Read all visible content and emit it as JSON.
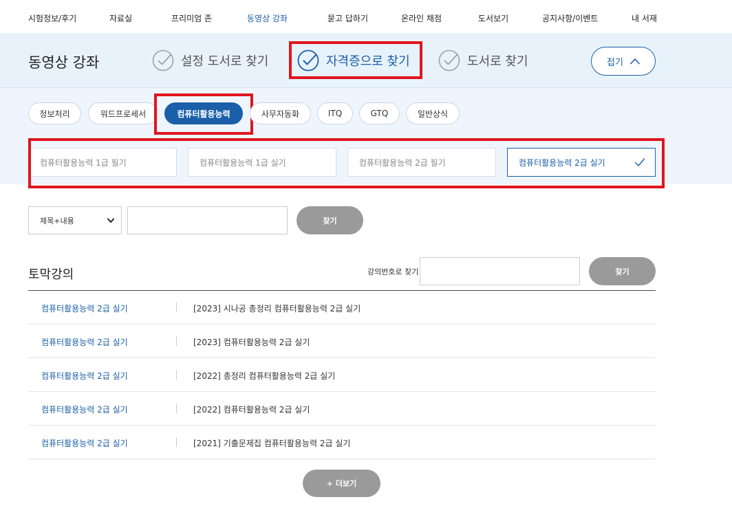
{
  "nav": {
    "items": [
      {
        "label": "시험정보/후기"
      },
      {
        "label": "자료실"
      },
      {
        "label": "프리미엄 존"
      },
      {
        "label": "동영상 강좌"
      },
      {
        "label": "묻고 답하기"
      },
      {
        "label": "온라인 채점"
      },
      {
        "label": "도서보기"
      },
      {
        "label": "공지사항/이벤트"
      },
      {
        "label": "내 서재"
      }
    ],
    "active": "동영상 강좌"
  },
  "header": {
    "title": "동영상 강좌",
    "modes": [
      {
        "label": "설정 도서로 찾기",
        "selected": false
      },
      {
        "label": "자격증으로 찾기",
        "selected": true
      },
      {
        "label": "도서로 찾기",
        "selected": false
      }
    ],
    "fold_label": "접기"
  },
  "categories": [
    {
      "label": "정보처리"
    },
    {
      "label": "워드프로세서"
    },
    {
      "label": "컴퓨터활용능력"
    },
    {
      "label": "사무자동화"
    },
    {
      "label": "ITQ"
    },
    {
      "label": "GTQ"
    },
    {
      "label": "일반상식"
    }
  ],
  "active_category": "컴퓨터활용능력",
  "levels": [
    {
      "label": "컴퓨터활용능력 1급 필기"
    },
    {
      "label": "컴퓨터활용능력 1급 실기"
    },
    {
      "label": "컴퓨터활용능력 2급 필기"
    },
    {
      "label": "컴퓨터활용능력 2급 실기"
    }
  ],
  "active_level": "컴퓨터활용능력 2급 실기",
  "search": {
    "select_value": "제목+내용",
    "input_value": "",
    "button_label": "찾기"
  },
  "section": {
    "title": "토막강의",
    "lecture_number_label": "강의번호로 찾기",
    "lecture_number_value": "",
    "button_label": "찾기"
  },
  "lectures": [
    {
      "category": "컴퓨터활용능력 2급 실기",
      "title": "[2023] 시나공 총정리 컴퓨터활용능력 2급 실기"
    },
    {
      "category": "컴퓨터활용능력 2급 실기",
      "title": "[2023] 컴퓨터활용능력 2급 실기"
    },
    {
      "category": "컴퓨터활용능력 2급 실기",
      "title": "[2022] 총정리 컴퓨터활용능력 2급 실기"
    },
    {
      "category": "컴퓨터활용능력 2급 실기",
      "title": "[2022] 컴퓨터활용능력 2급 실기"
    },
    {
      "category": "컴퓨터활용능력 2급 실기",
      "title": "[2021] 기출문제집 컴퓨터활용능력 2급 실기"
    }
  ],
  "more_label": "+ 더보기",
  "colors": {
    "accent": "#1a5fa8",
    "highlight": "#e0141e",
    "band": "#e8f2fb",
    "button_gray": "#9a9a9a"
  }
}
